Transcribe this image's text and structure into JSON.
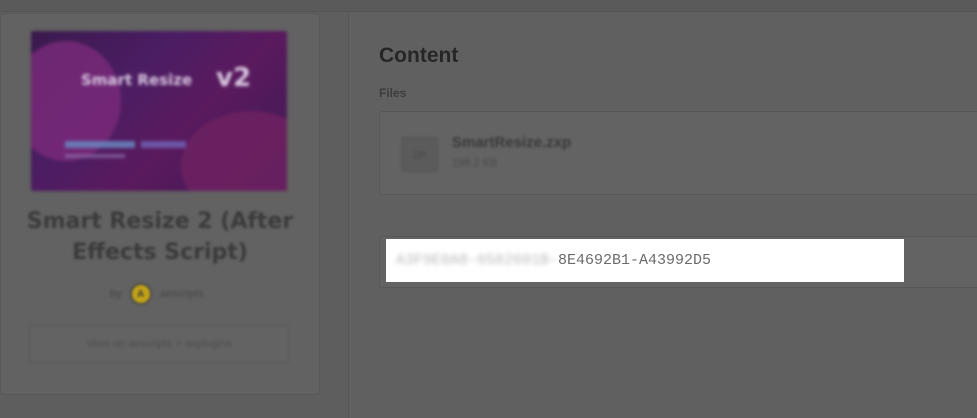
{
  "product": {
    "thumbnail_title": "Smart Resize",
    "thumbnail_version": "v2",
    "title": "Smart Resize 2 (After Effects Script)",
    "by_label": "by",
    "author_initial": "A",
    "author_name": "aescripts",
    "button_label": "View on aescripts + aeplugins"
  },
  "content": {
    "heading": "Content",
    "files_label": "Files",
    "file": {
      "icon": "file-icon",
      "icon_text": "ZIP",
      "name": "SmartResize.zxp",
      "size": "198.2 KB"
    },
    "license": {
      "key_hidden_part": "A3F9E0A8-6582601B-",
      "key_visible_part": "8E4692B1-A43992D5"
    }
  },
  "colors": {
    "overlay_gray": "#5e5e5e",
    "license_bg": "#ffffff",
    "license_text": "#6b6b6b",
    "author_avatar": "#c3a316",
    "thumbnail_purple": "#4b1d63"
  }
}
